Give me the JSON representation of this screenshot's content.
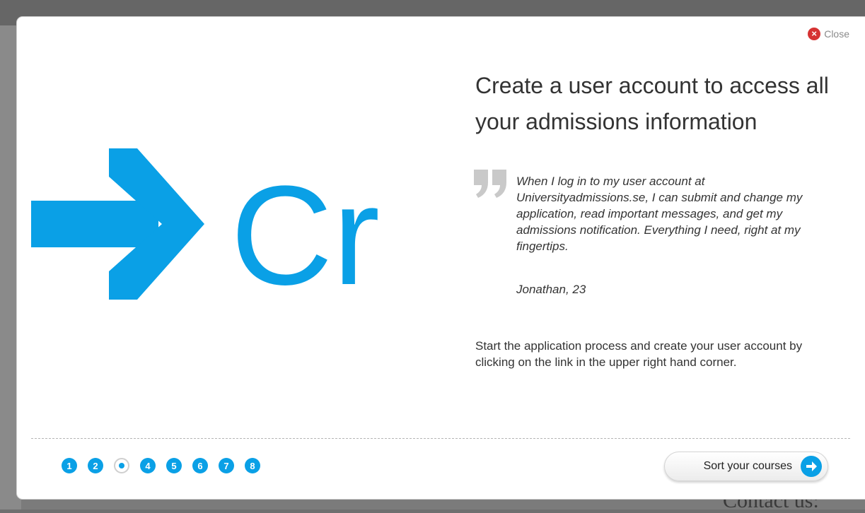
{
  "modal": {
    "close_label": "Close",
    "title": "Create a user account to access all your admissions information",
    "slide_image_text": "Cr",
    "quote": "When I log in to my user account at Universityadmissions.se, I can submit and change my application, read important messages, and get my admissions notification. Everything I need, right at my fingertips.",
    "quote_author": "Jonathan, 23",
    "body": "Start the application process and create your user account by clicking on the link in the upper right hand corner.",
    "next_label": "Sort your courses",
    "pager": [
      "1",
      "2",
      "",
      "4",
      "5",
      "6",
      "7",
      "8"
    ],
    "current_page": 3
  },
  "background_page": {
    "bottom_heading": "Contact us:"
  },
  "colors": {
    "accent": "#0aa0e6",
    "close": "#d63232"
  }
}
